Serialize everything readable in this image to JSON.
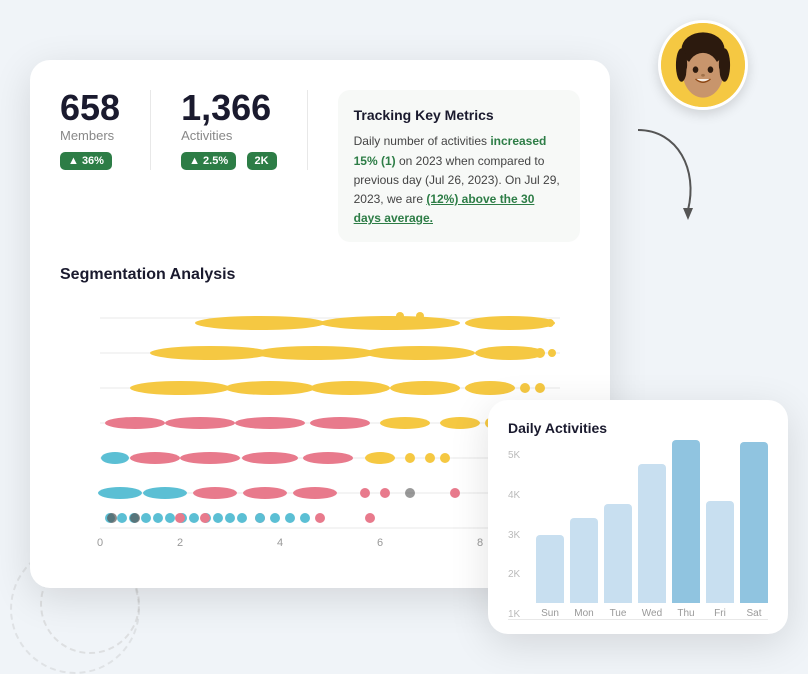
{
  "metrics": {
    "members": {
      "value": "658",
      "label": "Members",
      "badge": "▲ 36%"
    },
    "activities": {
      "value": "1,366",
      "label": "Activities",
      "badge": "▲ 2.5%",
      "extra": "2K"
    }
  },
  "tracking": {
    "title": "Tracking Key Metrics",
    "text_before_highlight1": "Daily number of activities ",
    "highlight1": "increased 15% (1)",
    "text_after_highlight1": " on 2023 when compared to previous day (Jul 26, 2023). On Jul 29, 2023, we are ",
    "highlight2": "(12%) above the 30 days average.",
    "highlight2_prefix": ""
  },
  "segmentation": {
    "title": "Segmentation Analysis"
  },
  "daily": {
    "title": "Daily Activities",
    "y_labels": [
      "5K",
      "4K",
      "3K",
      "2K",
      "1K"
    ],
    "bars": [
      {
        "label": "Sun",
        "value": 2000,
        "max": 5000
      },
      {
        "label": "Mon",
        "value": 2500,
        "max": 5000
      },
      {
        "label": "Tue",
        "value": 2900,
        "max": 5000
      },
      {
        "label": "Wed",
        "value": 4100,
        "max": 5000
      },
      {
        "label": "Thu",
        "value": 4800,
        "max": 5000
      },
      {
        "label": "Fri",
        "value": 3000,
        "max": 5000
      },
      {
        "label": "Sat",
        "value": 4750,
        "max": 5000
      }
    ]
  },
  "colors": {
    "green": "#2d7d46",
    "blue_bar": "#c8dff0",
    "pink": "#e87a8c",
    "yellow": "#f5c842",
    "teal": "#5bbfd4"
  }
}
